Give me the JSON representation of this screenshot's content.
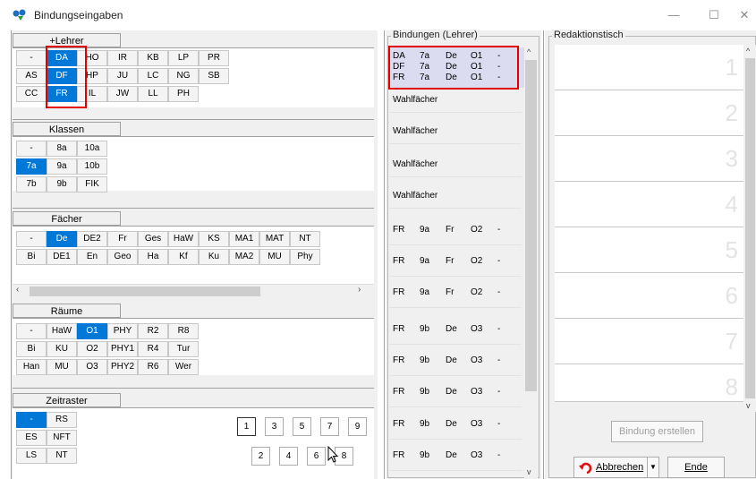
{
  "window": {
    "title": "Bindungseingaben",
    "min": "—",
    "max": "☐",
    "close": "✕"
  },
  "lehrer": {
    "header": "+Lehrer",
    "rows": [
      [
        "-",
        "DA",
        "HO",
        "IR",
        "KB",
        "LP",
        "PR"
      ],
      [
        "AS",
        "DF",
        "HP",
        "JU",
        "LC",
        "NG",
        "SB"
      ],
      [
        "CC",
        "FR",
        "IL",
        "JW",
        "LL",
        "PH",
        ""
      ]
    ]
  },
  "klassen": {
    "header": "Klassen",
    "rows": [
      [
        "-",
        "8a",
        "10a"
      ],
      [
        "7a",
        "9a",
        "10b"
      ],
      [
        "7b",
        "9b",
        "FIK"
      ]
    ]
  },
  "faecher": {
    "header": "Fächer",
    "rows": [
      [
        "-",
        "De",
        "DE2",
        "Fr",
        "Ges",
        "HaW",
        "KS",
        "MA1",
        "MAT",
        "NT"
      ],
      [
        "Bi",
        "DE1",
        "En",
        "Geo",
        "Ha",
        "Kf",
        "Ku",
        "MA2",
        "MU",
        "Phy"
      ]
    ]
  },
  "raeume": {
    "header": "Räume",
    "rows": [
      [
        "-",
        "HaW",
        "O1",
        "PHY",
        "R2",
        "R8"
      ],
      [
        "Bi",
        "KU",
        "O2",
        "PHY1",
        "R4",
        "Tur"
      ],
      [
        "Han",
        "MU",
        "O3",
        "PHY2",
        "R6",
        "Wer"
      ]
    ]
  },
  "zeitraster": {
    "header": "Zeitraster",
    "rows": [
      [
        "-",
        "RS"
      ],
      [
        "ES",
        "NFT"
      ],
      [
        "LS",
        "NT"
      ]
    ],
    "odd": [
      "1",
      "3",
      "5",
      "7",
      "9"
    ],
    "even": [
      "2",
      "4",
      "6",
      "8"
    ]
  },
  "bindungen": {
    "label": "Bindungen (Lehrer)",
    "top": [
      [
        "DA",
        "7a",
        "De",
        "O1",
        "-"
      ],
      [
        "DF",
        "7a",
        "De",
        "O1",
        "-"
      ],
      [
        "FR",
        "7a",
        "De",
        "O1",
        "-"
      ]
    ],
    "wahl": [
      "Wahlfächer",
      "Wahlfächer",
      "Wahlfächer",
      "Wahlfächer"
    ],
    "rows": [
      [
        "FR",
        "9a",
        "Fr",
        "O2",
        "-"
      ],
      [
        "FR",
        "9a",
        "Fr",
        "O2",
        "-"
      ],
      [
        "FR",
        "9a",
        "Fr",
        "O2",
        "-"
      ],
      [
        "FR",
        "9b",
        "De",
        "O3",
        "-"
      ],
      [
        "FR",
        "9b",
        "De",
        "O3",
        "-"
      ],
      [
        "FR",
        "9b",
        "De",
        "O3",
        "-"
      ],
      [
        "FR",
        "9b",
        "De",
        "O3",
        "-"
      ],
      [
        "FR",
        "9b",
        "De",
        "O3",
        "-"
      ]
    ]
  },
  "redaktion": {
    "label": "Redaktionstisch",
    "slots": [
      "1",
      "2",
      "3",
      "4",
      "5",
      "6",
      "7",
      "8"
    ],
    "create": "Bindung erstellen",
    "abbrechen": "Abbrechen",
    "ende": "Ende"
  },
  "colors": {
    "selected": "#0078d7",
    "highlight": "#e00000",
    "bindbg": "#dcdcf0"
  }
}
